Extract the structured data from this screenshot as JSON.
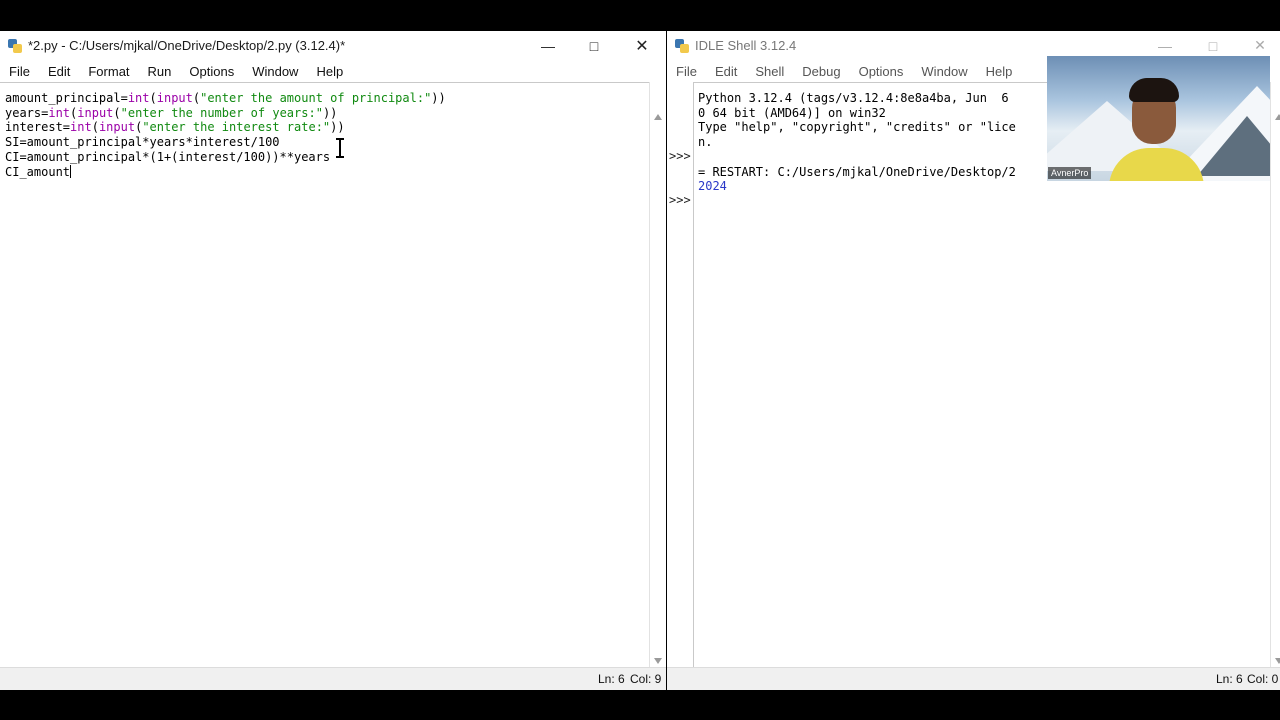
{
  "editor": {
    "title": "*2.py - C:/Users/mjkal/OneDrive/Desktop/2.py (3.12.4)*",
    "menu": [
      "File",
      "Edit",
      "Format",
      "Run",
      "Options",
      "Window",
      "Help"
    ],
    "lines": [
      {
        "parts": [
          {
            "t": "amount_principal="
          },
          {
            "t": "int",
            "c": "kw"
          },
          {
            "t": "("
          },
          {
            "t": "input",
            "c": "kw"
          },
          {
            "t": "("
          },
          {
            "t": "\"enter the amount of principal:\"",
            "c": "str"
          },
          {
            "t": "))"
          }
        ]
      },
      {
        "parts": [
          {
            "t": "years="
          },
          {
            "t": "int",
            "c": "kw"
          },
          {
            "t": "("
          },
          {
            "t": "input",
            "c": "kw"
          },
          {
            "t": "("
          },
          {
            "t": "\"enter the number of years:\"",
            "c": "str"
          },
          {
            "t": "))"
          }
        ]
      },
      {
        "parts": [
          {
            "t": "interest="
          },
          {
            "t": "int",
            "c": "kw"
          },
          {
            "t": "("
          },
          {
            "t": "input",
            "c": "kw"
          },
          {
            "t": "("
          },
          {
            "t": "\"enter the interest rate:\"",
            "c": "str"
          },
          {
            "t": "))"
          }
        ]
      },
      {
        "parts": [
          {
            "t": "SI=amount_principal*years*interest/100"
          }
        ]
      },
      {
        "parts": [
          {
            "t": "CI=amount_principal*(1+(interest/100))**years"
          }
        ]
      },
      {
        "parts": [
          {
            "t": "CI_amount"
          }
        ]
      }
    ],
    "status": {
      "ln": "Ln: 6",
      "col": "Col: 9"
    }
  },
  "shell": {
    "title": "IDLE Shell 3.12.4",
    "menu": [
      "File",
      "Edit",
      "Shell",
      "Debug",
      "Options",
      "Window",
      "Help"
    ],
    "prompts": [
      ">>>",
      ">>>"
    ],
    "lines": [
      {
        "t": "Python 3.12.4 (tags/v3.12.4:8e8a4ba, Jun  6",
        "c": ""
      },
      {
        "t": "0 64 bit (AMD64)] on win32",
        "c": ""
      },
      {
        "t": "Type \"help\", \"copyright\", \"credits\" or \"lice",
        "c": ""
      },
      {
        "t": "n.",
        "c": ""
      },
      {
        "t": "",
        "c": ""
      },
      {
        "t": "= RESTART: C:/Users/mjkal/OneDrive/Desktop/2",
        "c": ""
      },
      {
        "t": "2024",
        "c": "blue"
      }
    ],
    "status": {
      "ln": "Ln: 6",
      "col": "Col: 0"
    }
  },
  "webcam": {
    "name": "AvnerPro"
  }
}
